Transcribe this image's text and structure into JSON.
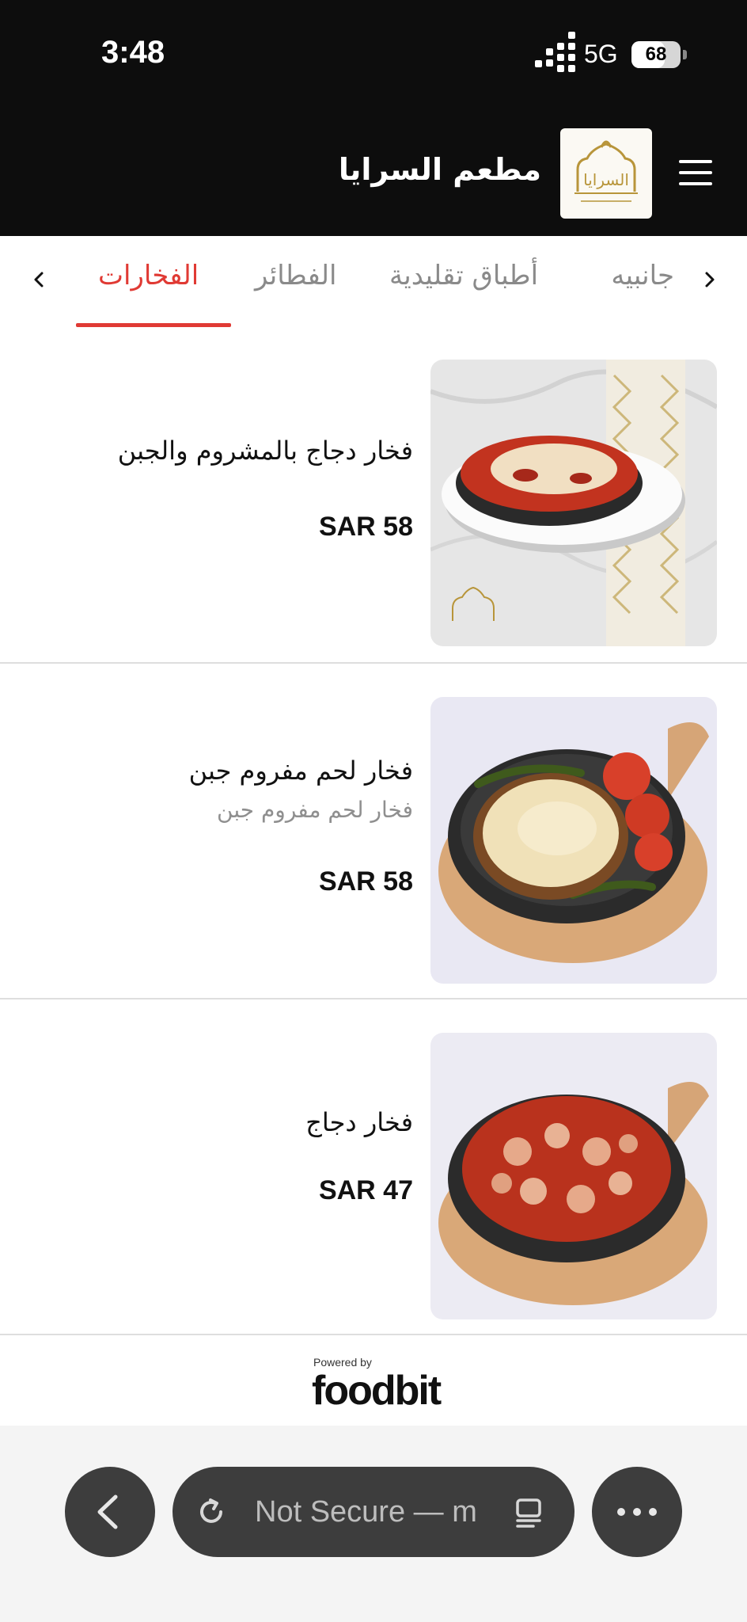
{
  "status_bar": {
    "time": "3:48",
    "network": "5G",
    "battery": "68",
    "battery_level_percent": 68
  },
  "header": {
    "restaurant_name": "مطعم السرايا",
    "logo_text": "السرايا"
  },
  "tabs": [
    {
      "label": "جانبيه",
      "active": false
    },
    {
      "label": "أطباق تقليدية",
      "active": false
    },
    {
      "label": "الفطائر",
      "active": false
    },
    {
      "label": "الفخارات",
      "active": true
    }
  ],
  "items": [
    {
      "name": "فخار دجاج بالمشروم والجبن",
      "description": "",
      "price": "SAR 58"
    },
    {
      "name": "فخار لحم مفروم جبن",
      "description": "فخار لحم مفروم جبن",
      "price": "SAR 58"
    },
    {
      "name": "فخار دجاج",
      "description": "",
      "price": "SAR 47"
    }
  ],
  "footer": {
    "powered_by": "Powered by",
    "brand": "foodbit"
  },
  "browser": {
    "url_text": "Not Secure — m"
  },
  "icons": {
    "back": "chevron-left-icon",
    "reload": "reload-icon",
    "reader": "reader-mode-icon",
    "more": "more-dots-icon",
    "menu": "hamburger-menu-icon"
  },
  "colors": {
    "header_bg": "#0d0d0d",
    "accent": "#e03a34",
    "logo_gold": "#b8953a"
  }
}
